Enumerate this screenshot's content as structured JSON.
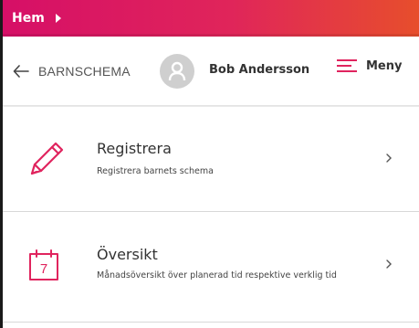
{
  "topbar": {
    "breadcrumb": "Hem",
    "colors": [
      "#d60f67",
      "#e74e2c"
    ]
  },
  "header": {
    "back_icon": "arrow-left-icon",
    "title": "BARNSCHEMA",
    "avatar_icon": "user-icon",
    "user_name": "Bob Andersson",
    "menu_icon": "hamburger-icon",
    "menu_label": "Meny",
    "accent_color": "#e0245e"
  },
  "items": [
    {
      "icon": "pencil-icon",
      "title": "Registrera",
      "description": "Registrera barnets schema"
    },
    {
      "icon": "calendar-icon",
      "calendar_day": "7",
      "title": "Översikt",
      "description": "Månadsöversikt över planerad tid respektive verklig tid"
    }
  ]
}
